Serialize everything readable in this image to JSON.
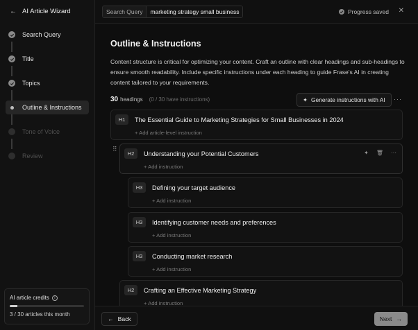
{
  "sidebar": {
    "title": "AI Article Wizard",
    "steps": [
      {
        "label": "Search Query"
      },
      {
        "label": "Title"
      },
      {
        "label": "Topics"
      },
      {
        "label": "Outline & Instructions"
      },
      {
        "label": "Tone of Voice"
      },
      {
        "label": "Review"
      }
    ],
    "credits": {
      "title": "AI article credits",
      "usage_text": "3 / 30 articles this month",
      "used": 3,
      "total": 30
    }
  },
  "topbar": {
    "query_label": "Search Query",
    "query_value": "marketing strategy small business",
    "status_text": "Progress saved"
  },
  "main": {
    "title": "Outline & Instructions",
    "description": "Content structure is critical for optimizing your content. Craft an outline with clear headings and sub-headings to ensure smooth readability. Include specific instructions under each heading to guide Frase's AI in creating content tailored to your requirements.",
    "headings_count": "30",
    "headings_unit": "headings",
    "instructions_status": "(0 / 30 have instructions)",
    "generate_label": "Generate instructions with AI",
    "outline": [
      {
        "level": "H1",
        "text": "The Essential Guide to Marketing Strategies for Small Businesses in 2024",
        "add": "+ Add article-level instruction"
      },
      {
        "level": "H2",
        "text": "Understanding your Potential Customers",
        "add": "+ Add instruction"
      },
      {
        "level": "H3",
        "text": "Defining your target audience",
        "add": "+ Add instruction"
      },
      {
        "level": "H3",
        "text": "Identifying customer needs and preferences",
        "add": "+ Add instruction"
      },
      {
        "level": "H3",
        "text": "Conducting market research",
        "add": "+ Add instruction"
      },
      {
        "level": "H2",
        "text": "Crafting an Effective Marketing Strategy",
        "add": "+ Add instruction"
      }
    ]
  },
  "footer": {
    "back_label": "Back",
    "next_label": "Next"
  }
}
